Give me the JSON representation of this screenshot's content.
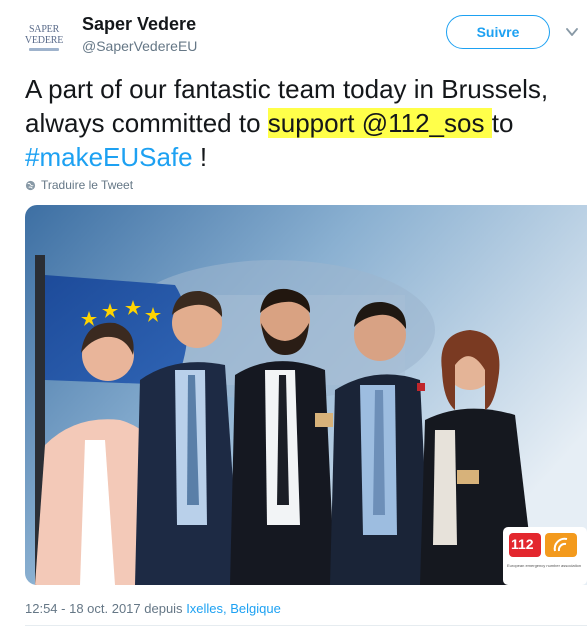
{
  "author": {
    "avatar_line1": "SAPER",
    "avatar_line2": "VEDERE",
    "name": "Saper Vedere",
    "handle": "@SaperVedereEU"
  },
  "follow_button": {
    "label": "Suivre"
  },
  "menu_icon": "chevron-down-icon",
  "tweet": {
    "text_part1": "A part of our fantastic team today in Brussels, always committed to",
    "text_highlight": "support @112_sos",
    "text_part2": "to",
    "hashtag": "#makeEUSafe",
    "text_end": "!",
    "highlight_color": "#ffff4a",
    "link_color": "#1da1f2",
    "translate_label": "Traduire le Tweet",
    "translate_icon": "globe-icon"
  },
  "photo": {
    "logo_number": "112",
    "logo_caption": "European emergency number association"
  },
  "footer": {
    "time": "12:54 - 18 oct. 2017 depuis",
    "location": "Ixelles, Belgique"
  }
}
